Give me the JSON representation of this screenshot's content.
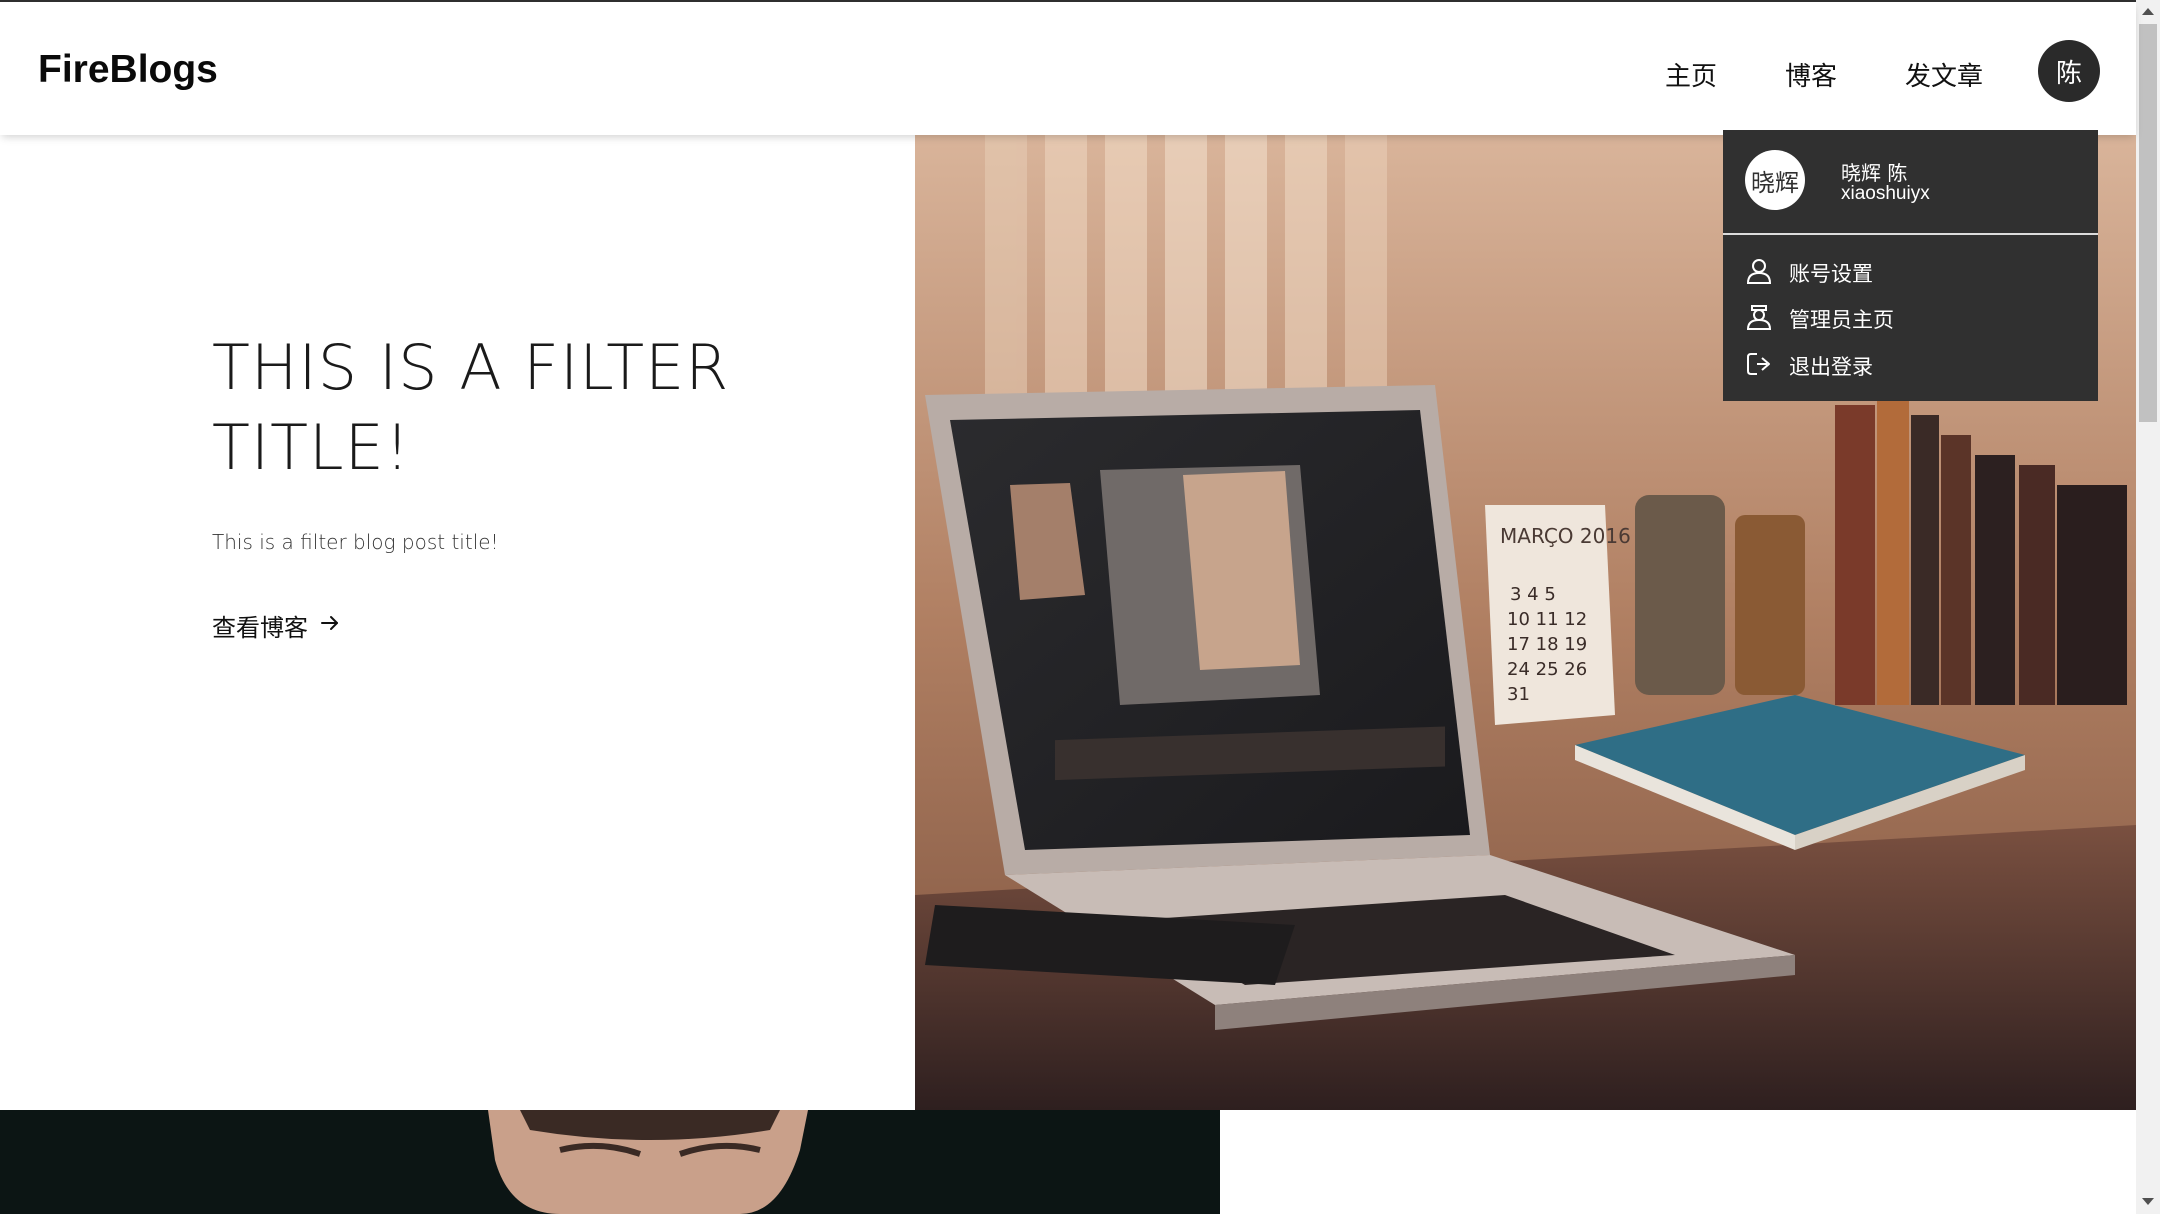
{
  "header": {
    "brand": "FireBlogs",
    "nav": {
      "home": "主页",
      "blogs": "博客",
      "write": "发文章"
    },
    "avatar_initial": "陈"
  },
  "dropdown": {
    "avatar_text": "晓辉",
    "full_name": "晓辉 陈",
    "username": "xiaoshuiyx",
    "items": [
      {
        "label": "账号设置",
        "icon": "user-icon"
      },
      {
        "label": "管理员主页",
        "icon": "admin-icon"
      },
      {
        "label": "退出登录",
        "icon": "logout-icon"
      }
    ]
  },
  "hero": {
    "title": "THIS IS A FILTER TITLE!",
    "subtitle": "This is a filter blog post title!",
    "link_label": "查看博客",
    "link_icon": "arrow-right-icon"
  },
  "images": {
    "hero_photo": "laptop-on-desk-photo",
    "second_card_photo": "portrait-photo"
  },
  "colors": {
    "dropdown_bg": "#303030",
    "avatar_bg": "#2a2a2a",
    "second_card_bg": "#0c1514"
  }
}
